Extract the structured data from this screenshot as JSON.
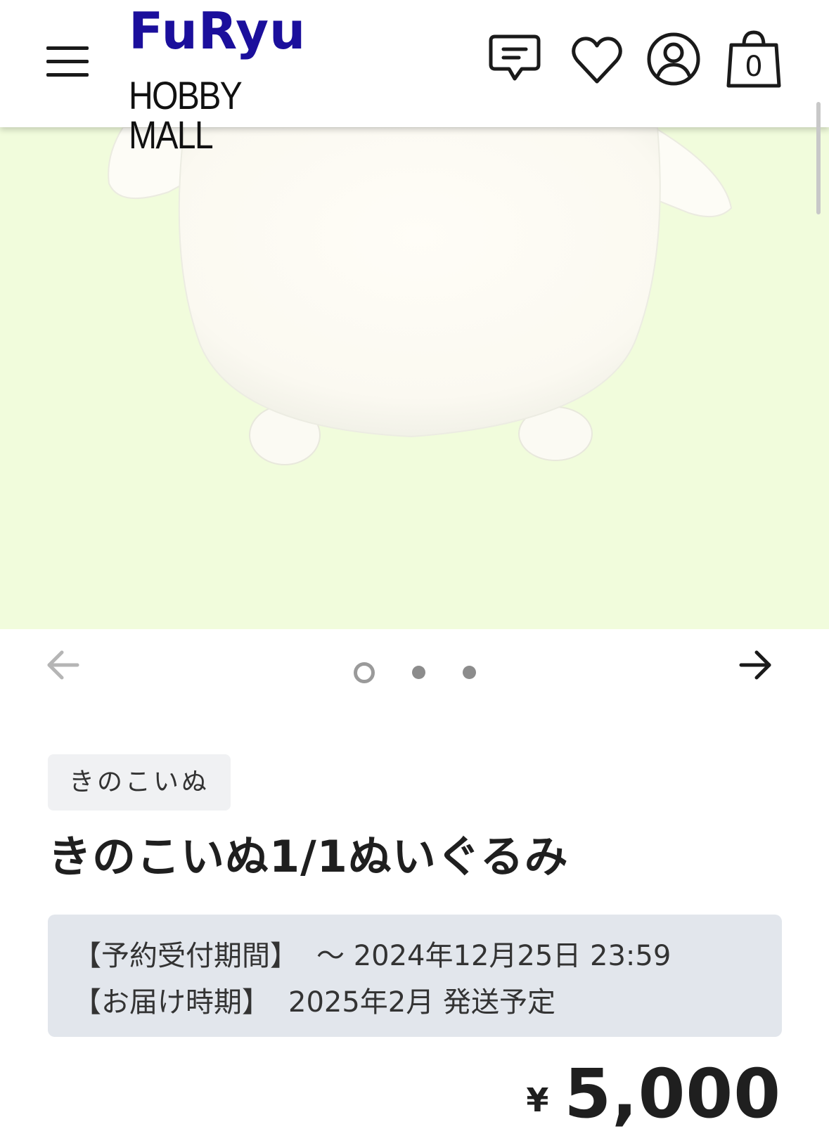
{
  "header": {
    "logo_top": "FuRyu",
    "logo_bottom": "HOBBY MALL",
    "cart_count": "0"
  },
  "carousel": {
    "total_slides": 3,
    "active_slide": 1
  },
  "product": {
    "category": "きのこいぬ",
    "title": "きのこいぬ1/1ぬいぐるみ",
    "reservation_label": "【予約受付期間】",
    "reservation_value": "～ 2024年12月25日 23:59",
    "delivery_label": "【お届け時期】",
    "delivery_value": "2025年2月 発送予定",
    "price_symbol": "¥",
    "price_value": "5,000"
  },
  "colors": {
    "brand": "#1b0f9c",
    "image_background": "#f1fcdc",
    "info_box": "#e2e6ec",
    "tag_background": "#f0f1f3"
  },
  "icons": [
    "menu-icon",
    "chat-icon",
    "heart-icon",
    "account-icon",
    "cart-icon",
    "arrow-left-icon",
    "arrow-right-icon"
  ]
}
